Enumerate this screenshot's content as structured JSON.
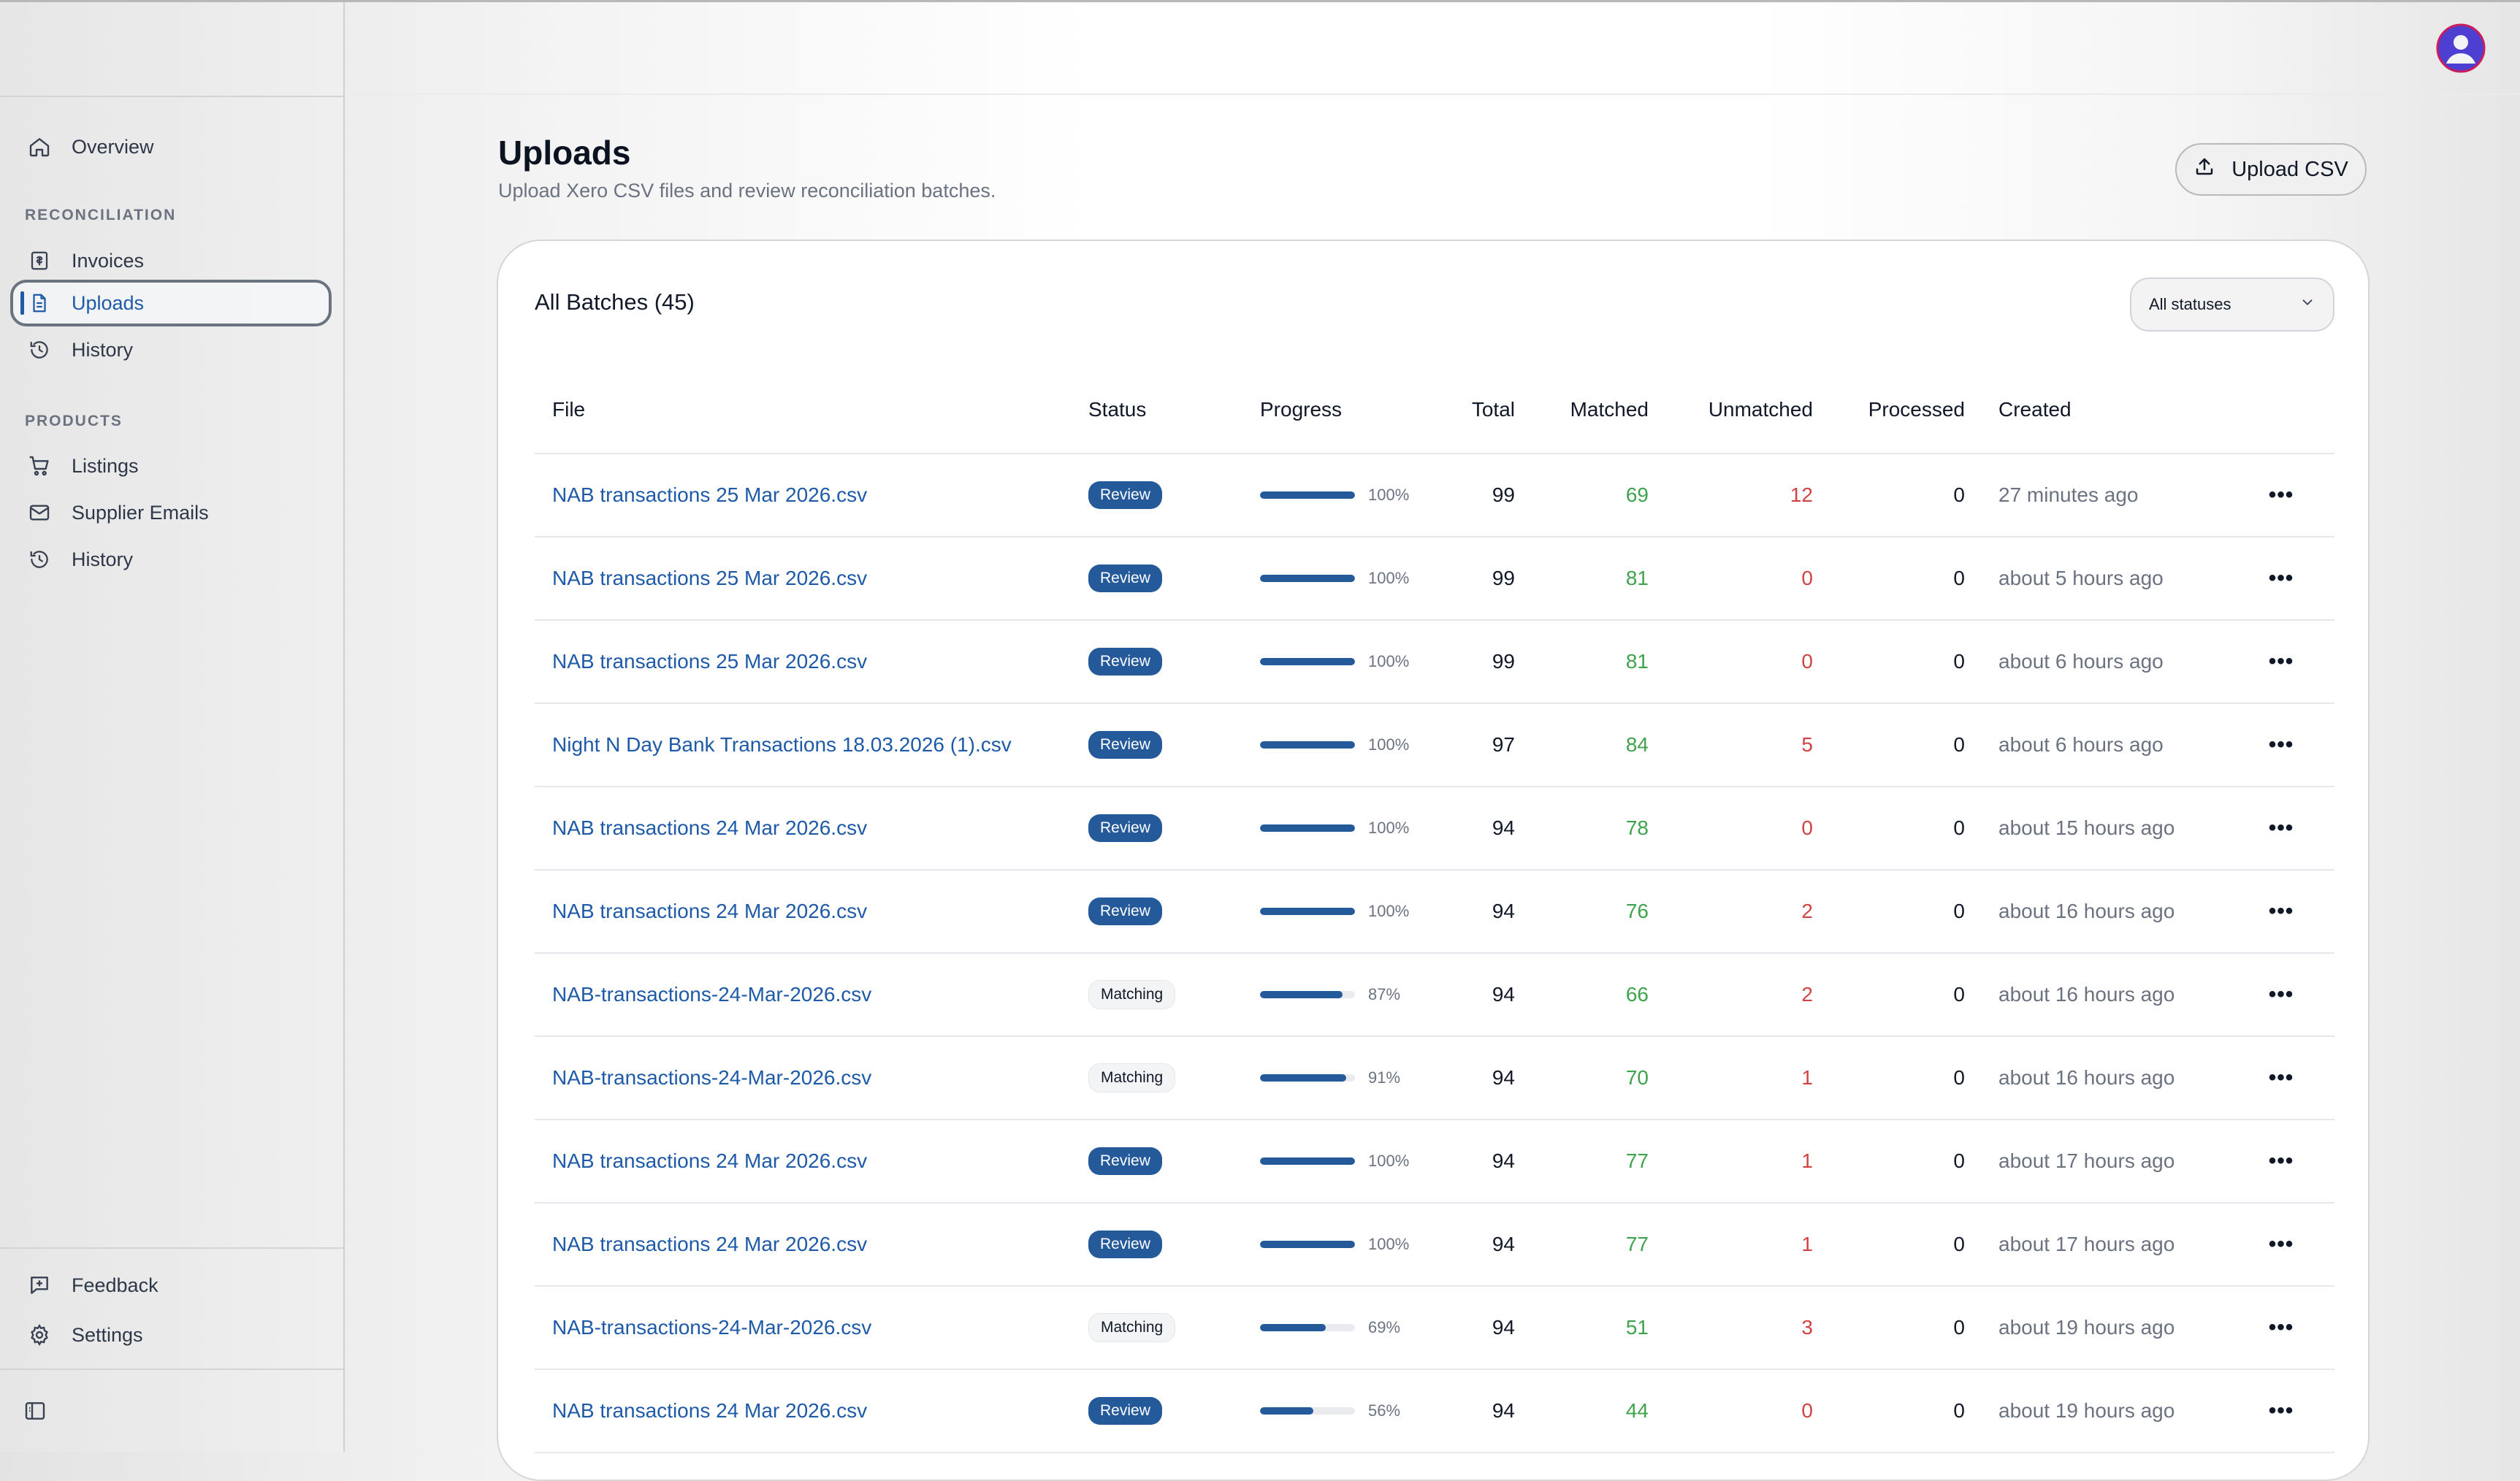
{
  "sidebar": {
    "top_items": [
      {
        "label": "Overview",
        "icon": "home-icon"
      }
    ],
    "sections": [
      {
        "label": "RECONCILIATION",
        "items": [
          {
            "label": "Invoices",
            "icon": "invoice-icon"
          },
          {
            "label": "Uploads",
            "icon": "file-icon",
            "active": true
          },
          {
            "label": "History",
            "icon": "history-icon"
          }
        ]
      },
      {
        "label": "PRODUCTS",
        "items": [
          {
            "label": "Listings",
            "icon": "cart-icon"
          },
          {
            "label": "Supplier Emails",
            "icon": "mail-icon"
          },
          {
            "label": "History",
            "icon": "history-icon"
          }
        ]
      }
    ],
    "footer_items": [
      {
        "label": "Feedback",
        "icon": "feedback-icon"
      },
      {
        "label": "Settings",
        "icon": "gear-icon"
      }
    ]
  },
  "header": {
    "avatar_icon": "user-avatar-icon"
  },
  "page": {
    "title": "Uploads",
    "subtitle": "Upload Xero CSV files and review reconciliation batches.",
    "upload_button": "Upload CSV"
  },
  "card": {
    "title": "All Batches (45)",
    "status_filter": "All statuses"
  },
  "table": {
    "columns": [
      "File",
      "Status",
      "Progress",
      "Total",
      "Matched",
      "Unmatched",
      "Processed",
      "Created"
    ],
    "rows": [
      {
        "file": "NAB transactions 25 Mar 2026.csv",
        "status": "Review",
        "progress": 100,
        "progress_label": "100%",
        "total": "99",
        "matched": "69",
        "unmatched": "12",
        "processed": "0",
        "created": "27 minutes ago"
      },
      {
        "file": "NAB transactions 25 Mar 2026.csv",
        "status": "Review",
        "progress": 100,
        "progress_label": "100%",
        "total": "99",
        "matched": "81",
        "unmatched": "0",
        "processed": "0",
        "created": "about 5 hours ago"
      },
      {
        "file": "NAB transactions 25 Mar 2026.csv",
        "status": "Review",
        "progress": 100,
        "progress_label": "100%",
        "total": "99",
        "matched": "81",
        "unmatched": "0",
        "processed": "0",
        "created": "about 6 hours ago"
      },
      {
        "file": "Night N Day Bank Transactions 18.03.2026 (1).csv",
        "status": "Review",
        "progress": 100,
        "progress_label": "100%",
        "total": "97",
        "matched": "84",
        "unmatched": "5",
        "processed": "0",
        "created": "about 6 hours ago"
      },
      {
        "file": "NAB transactions 24 Mar 2026.csv",
        "status": "Review",
        "progress": 100,
        "progress_label": "100%",
        "total": "94",
        "matched": "78",
        "unmatched": "0",
        "processed": "0",
        "created": "about 15 hours ago"
      },
      {
        "file": "NAB transactions 24 Mar 2026.csv",
        "status": "Review",
        "progress": 100,
        "progress_label": "100%",
        "total": "94",
        "matched": "76",
        "unmatched": "2",
        "processed": "0",
        "created": "about 16 hours ago"
      },
      {
        "file": "NAB-transactions-24-Mar-2026.csv",
        "status": "Matching",
        "progress": 87,
        "progress_label": "87%",
        "total": "94",
        "matched": "66",
        "unmatched": "2",
        "processed": "0",
        "created": "about 16 hours ago"
      },
      {
        "file": "NAB-transactions-24-Mar-2026.csv",
        "status": "Matching",
        "progress": 91,
        "progress_label": "91%",
        "total": "94",
        "matched": "70",
        "unmatched": "1",
        "processed": "0",
        "created": "about 16 hours ago"
      },
      {
        "file": "NAB transactions 24 Mar 2026.csv",
        "status": "Review",
        "progress": 100,
        "progress_label": "100%",
        "total": "94",
        "matched": "77",
        "unmatched": "1",
        "processed": "0",
        "created": "about 17 hours ago"
      },
      {
        "file": "NAB transactions 24 Mar 2026.csv",
        "status": "Review",
        "progress": 100,
        "progress_label": "100%",
        "total": "94",
        "matched": "77",
        "unmatched": "1",
        "processed": "0",
        "created": "about 17 hours ago"
      },
      {
        "file": "NAB-transactions-24-Mar-2026.csv",
        "status": "Matching",
        "progress": 69,
        "progress_label": "69%",
        "total": "94",
        "matched": "51",
        "unmatched": "3",
        "processed": "0",
        "created": "about 19 hours ago"
      },
      {
        "file": "NAB transactions 24 Mar 2026.csv",
        "status": "Review",
        "progress": 56,
        "progress_label": "56%",
        "total": "94",
        "matched": "44",
        "unmatched": "0",
        "processed": "0",
        "created": "about 19 hours ago"
      }
    ]
  },
  "colors": {
    "accent": "#1e5aa8",
    "matched": "#3fa34d",
    "unmatched": "#d14343"
  }
}
